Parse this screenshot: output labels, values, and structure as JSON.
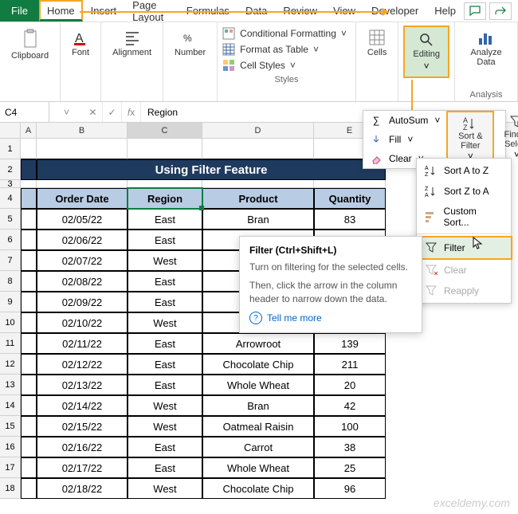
{
  "tabs": {
    "file": "File",
    "home": "Home",
    "insert": "Insert",
    "page_layout": "Page Layout",
    "formulas": "Formulas",
    "data": "Data",
    "review": "Review",
    "view": "View",
    "developer": "Developer",
    "help": "Help"
  },
  "ribbon": {
    "clipboard": "Clipboard",
    "font": "Font",
    "alignment": "Alignment",
    "number": "Number",
    "cond_format": "Conditional Formatting",
    "format_table": "Format as Table",
    "cell_styles": "Cell Styles",
    "styles": "Styles",
    "cells": "Cells",
    "editing": "Editing",
    "analyze": "Analyze Data",
    "analysis": "Analysis"
  },
  "editing_menu": {
    "autosum": "AutoSum",
    "fill": "Fill",
    "clear": "Clear",
    "sort_filter": "Sort & Filter",
    "find_select": "Find & Select"
  },
  "sort_menu": {
    "az": "Sort A to Z",
    "za": "Sort Z to A",
    "custom": "Custom Sort...",
    "filter": "Filter",
    "clear": "Clear",
    "reapply": "Reapply"
  },
  "tooltip": {
    "title": "Filter (Ctrl+Shift+L)",
    "body1": "Turn on filtering for the selected cells.",
    "body2": "Then, click the arrow in the column header to narrow down the data.",
    "link": "Tell me more"
  },
  "formula_bar": {
    "name_box": "C4",
    "value": "Region"
  },
  "columns": [
    "A",
    "B",
    "C",
    "D",
    "E"
  ],
  "sheet": {
    "title": "Using Filter Feature",
    "headers": {
      "b": "Order Date",
      "c": "Region",
      "d": "Product",
      "e": "Quantity"
    },
    "rows": [
      {
        "n": "5",
        "b": "02/05/22",
        "c": "East",
        "d": "Bran",
        "e": "83"
      },
      {
        "n": "6",
        "b": "02/06/22",
        "c": "East",
        "d": "O",
        "e": ""
      },
      {
        "n": "7",
        "b": "02/07/22",
        "c": "West",
        "d": "",
        "e": ""
      },
      {
        "n": "8",
        "b": "02/08/22",
        "c": "East",
        "d": "",
        "e": ""
      },
      {
        "n": "9",
        "b": "02/09/22",
        "c": "East",
        "d": "Cl",
        "e": ""
      },
      {
        "n": "10",
        "b": "02/10/22",
        "c": "West",
        "d": "",
        "e": ""
      },
      {
        "n": "11",
        "b": "02/11/22",
        "c": "East",
        "d": "Arrowroot",
        "e": "139"
      },
      {
        "n": "12",
        "b": "02/12/22",
        "c": "East",
        "d": "Chocolate Chip",
        "e": "211"
      },
      {
        "n": "13",
        "b": "02/13/22",
        "c": "East",
        "d": "Whole Wheat",
        "e": "20"
      },
      {
        "n": "14",
        "b": "02/14/22",
        "c": "West",
        "d": "Bran",
        "e": "42"
      },
      {
        "n": "15",
        "b": "02/15/22",
        "c": "West",
        "d": "Oatmeal Raisin",
        "e": "100"
      },
      {
        "n": "16",
        "b": "02/16/22",
        "c": "East",
        "d": "Carrot",
        "e": "38"
      },
      {
        "n": "17",
        "b": "02/17/22",
        "c": "East",
        "d": "Whole Wheat",
        "e": "25"
      },
      {
        "n": "18",
        "b": "02/18/22",
        "c": "West",
        "d": "Chocolate Chip",
        "e": "96"
      }
    ]
  },
  "watermark": "exceldemy.com"
}
